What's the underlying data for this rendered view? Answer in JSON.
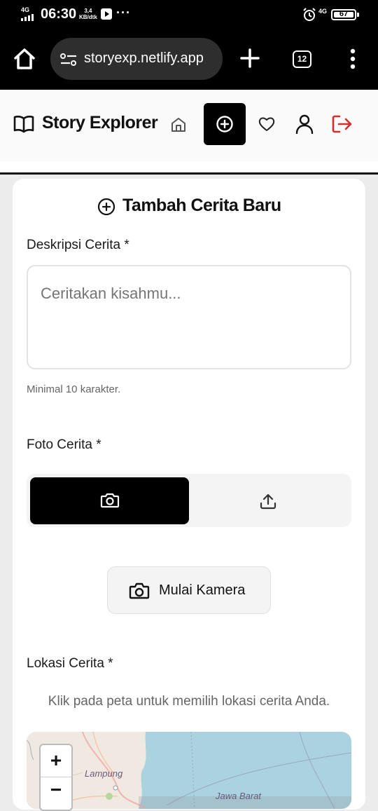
{
  "status_bar": {
    "network": "4G",
    "time": "06:30",
    "speed_value": "3,4",
    "speed_unit": "KB/dtk",
    "more": "···",
    "network_right": "4G",
    "battery": "67"
  },
  "browser": {
    "url": "storyexp.netlify.app",
    "tab_count": "12",
    "icons": [
      "home-icon",
      "site-settings-icon",
      "new-tab-icon",
      "tabs-icon",
      "menu-icon"
    ]
  },
  "header": {
    "brand": "Story Explorer",
    "nav_icons": [
      "home-icon",
      "add-story-icon",
      "favorite-icon",
      "profile-icon",
      "logout-icon"
    ],
    "logout_color": "#d32f2f"
  },
  "form": {
    "title": "Tambah Cerita Baru",
    "description_label": "Deskripsi Cerita *",
    "description_placeholder": "Ceritakan kisahmu...",
    "description_hint": "Minimal 10 karakter.",
    "photo_label": "Foto Cerita *",
    "photo_modes": [
      "camera",
      "upload"
    ],
    "photo_mode_selected": "camera",
    "start_camera": "Mulai Kamera",
    "location_label": "Lokasi Cerita *",
    "location_hint": "Klik pada peta untuk memilih lokasi cerita Anda."
  },
  "map": {
    "zoom_in": "+",
    "zoom_out": "−",
    "labels": [
      "Lampung",
      "Jawa Barat"
    ]
  }
}
